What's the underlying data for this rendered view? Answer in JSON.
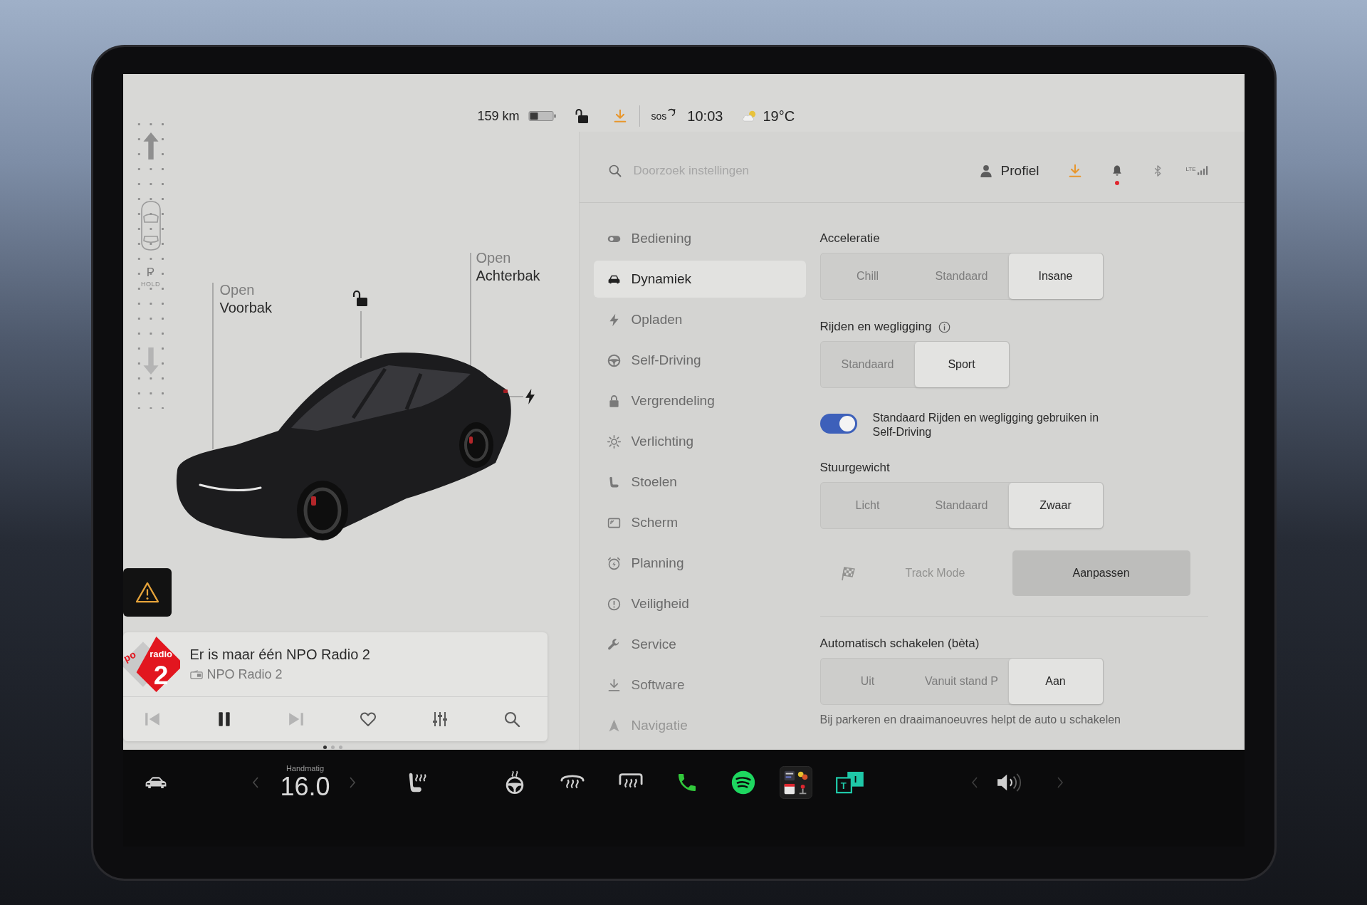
{
  "status_bar": {
    "range": "159 km",
    "locked": false,
    "sos": "sos",
    "time": "10:03",
    "temperature": "19°C"
  },
  "gear_selector": {
    "gear": "P",
    "hold": "HOLD"
  },
  "vehicle": {
    "locked": false,
    "frunk": {
      "action": "Open",
      "label": "Voorbak"
    },
    "trunk": {
      "action": "Open",
      "label": "Achterbak"
    }
  },
  "media": {
    "logo": {
      "brand": "po",
      "name": "radio",
      "number": "2"
    },
    "title": "Er is maar één NPO Radio 2",
    "source": "NPO Radio 2",
    "controls": [
      {
        "kind": "previous",
        "disabled": true
      },
      {
        "kind": "pause",
        "disabled": false
      },
      {
        "kind": "next",
        "disabled": true
      },
      {
        "kind": "favorite",
        "disabled": false
      },
      {
        "kind": "equalizer",
        "disabled": false
      },
      {
        "kind": "search",
        "disabled": false
      }
    ],
    "pages": [
      {
        "selected": true
      },
      {
        "selected": false
      },
      {
        "selected": false
      }
    ]
  },
  "settings": {
    "search": {
      "placeholder": "Doorzoek instellingen"
    },
    "profile": "Profiel",
    "notifications": true,
    "network": "LTE",
    "menu": [
      {
        "label": "Bediening",
        "selected": false
      },
      {
        "label": "Dynamiek",
        "selected": true
      },
      {
        "label": "Opladen",
        "selected": false
      },
      {
        "label": "Self-Driving",
        "selected": false
      },
      {
        "label": "Vergrendeling",
        "selected": false
      },
      {
        "label": "Verlichting",
        "selected": false
      },
      {
        "label": "Stoelen",
        "selected": false
      },
      {
        "label": "Scherm",
        "selected": false
      },
      {
        "label": "Planning",
        "selected": false
      },
      {
        "label": "Veiligheid",
        "selected": false
      },
      {
        "label": "Service",
        "selected": false
      },
      {
        "label": "Software",
        "selected": false
      },
      {
        "label": "Navigatie",
        "selected": false
      }
    ],
    "sections": [
      {
        "kind": "segmented",
        "title": "Acceleratie",
        "info": false,
        "options": [
          {
            "label": "Chill",
            "selected": false
          },
          {
            "label": "Standaard",
            "selected": false
          },
          {
            "label": "Insane",
            "selected": true
          }
        ]
      },
      {
        "kind": "segmented",
        "title": "Rijden en wegligging",
        "info": true,
        "options": [
          {
            "label": "Standaard",
            "selected": false
          },
          {
            "label": "Sport",
            "selected": true
          }
        ]
      },
      {
        "kind": "toggle",
        "label": "Standaard Rijden en wegligging gebruiken in Self-Driving",
        "on": true
      },
      {
        "kind": "segmented",
        "title": "Stuurgewicht",
        "info": false,
        "options": [
          {
            "label": "Licht",
            "selected": false
          },
          {
            "label": "Standaard",
            "selected": false
          },
          {
            "label": "Zwaar",
            "selected": true
          }
        ]
      },
      {
        "kind": "action",
        "label": "Track Mode",
        "disabled": true,
        "button": "Aanpassen"
      },
      {
        "kind": "segmented",
        "title": "Automatisch schakelen (bèta)",
        "info": false,
        "options": [
          {
            "label": "Uit",
            "selected": false
          },
          {
            "label": "Vanuit stand P",
            "selected": false
          },
          {
            "label": "Aan",
            "selected": true
          }
        ],
        "note": "Bij parkeren en draaimanoeuvres helpt de auto u schakelen"
      }
    ]
  },
  "dock": {
    "climate_mode": "Handmatig",
    "temperature": "16.0",
    "tile_letters": [
      "T",
      "I"
    ]
  }
}
